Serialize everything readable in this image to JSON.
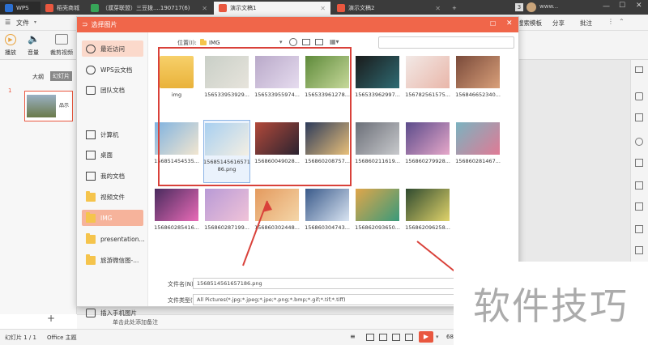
{
  "titlebar": {
    "tabs": [
      {
        "label": "WPS",
        "color": "#2b6fd1"
      },
      {
        "label": "稻壳商城",
        "color": "#e9573f"
      },
      {
        "label": "（濮芽联盟）三豆拨....190717(6)",
        "color": "#37a558"
      },
      {
        "label": "演示文稿1",
        "color": "#e9573f"
      },
      {
        "label": "演示文稿2",
        "color": "#e9573f"
      }
    ],
    "badge": "3",
    "user": "www..."
  },
  "menu": {
    "file": "文件",
    "search_template": "搜索模板",
    "share": "分享",
    "annotate": "批注"
  },
  "toolbar": {
    "play": "播放",
    "volume": "音量",
    "clip_video": "裁剪视频"
  },
  "leftpanel": {
    "outline": "大纲",
    "slides": "幻灯片",
    "slide_no": "1",
    "thumb_text": "品示"
  },
  "dialog": {
    "title": "选择图片",
    "location_label": "位置(I):",
    "location_value": "IMG",
    "sidebar": [
      {
        "label": "最近访问",
        "icon": "clock-icon"
      },
      {
        "label": "WPS云文档",
        "icon": "cloud-icon"
      },
      {
        "label": "团队文档",
        "icon": "team-icon"
      },
      {
        "label": "计算机",
        "icon": "computer-icon"
      },
      {
        "label": "桌面",
        "icon": "desktop-icon"
      },
      {
        "label": "我的文档",
        "icon": "documents-icon"
      },
      {
        "label": "视频文件",
        "icon": "folder-icon"
      },
      {
        "label": "IMG",
        "icon": "folder-icon"
      },
      {
        "label": "presentation...",
        "icon": "folder-icon"
      },
      {
        "label": "旅游微信图-...",
        "icon": "folder-icon"
      }
    ],
    "insert_phone": "插入手机图片",
    "files": [
      {
        "name": "img",
        "kind": "folder"
      },
      {
        "name": "156533953929...",
        "colors": [
          "#c9cfc7",
          "#e7e4dc"
        ]
      },
      {
        "name": "156533955974...",
        "colors": [
          "#b9a9c9",
          "#e6dcef"
        ]
      },
      {
        "name": "156533961278...",
        "colors": [
          "#5e8a3a",
          "#c7d99b"
        ]
      },
      {
        "name": "156533962997...",
        "colors": [
          "#1a1a1a",
          "#2f6c74"
        ]
      },
      {
        "name": "156782561575...",
        "colors": [
          "#f2e9e6",
          "#e9b6a9"
        ]
      },
      {
        "name": "156846652340...",
        "colors": [
          "#7a4a3a",
          "#d9a07a"
        ]
      },
      {
        "name": "156851454535...",
        "colors": [
          "#7fb2e0",
          "#f2e6d0"
        ]
      },
      {
        "name": "15685145616571 86.png",
        "colors": [
          "#a8cff0",
          "#f4efe3"
        ]
      },
      {
        "name": "156860049028...",
        "colors": [
          "#b2493a",
          "#2b2330"
        ]
      },
      {
        "name": "156860208757...",
        "colors": [
          "#2d3b5a",
          "#e9c07a"
        ]
      },
      {
        "name": "156860211619...",
        "colors": [
          "#6b6f78",
          "#c8c9cc"
        ]
      },
      {
        "name": "156860279928...",
        "colors": [
          "#5b4b8a",
          "#e6a7c9"
        ]
      },
      {
        "name": "156860281467...",
        "colors": [
          "#7ab3c0",
          "#e07a95"
        ]
      },
      {
        "name": "156860285416...",
        "colors": [
          "#4a2b5e",
          "#e96bb7"
        ]
      },
      {
        "name": "156860287199...",
        "colors": [
          "#b89ad6",
          "#f0c3d8"
        ]
      },
      {
        "name": "156860302448...",
        "colors": [
          "#e49a5e",
          "#f4d6a8"
        ]
      },
      {
        "name": "156860304743...",
        "colors": [
          "#3a5a8a",
          "#d9e4f2"
        ]
      },
      {
        "name": "156862093650...",
        "colors": [
          "#e0a64a",
          "#3a9a7a"
        ]
      },
      {
        "name": "156862096258...",
        "colors": [
          "#2f4a2f",
          "#e0d36a"
        ]
      }
    ],
    "filename_label": "文件名(N):",
    "filename_value": "1568514561657186.png",
    "filetype_label": "文件类型(T):",
    "filetype_value": "All Pictures(*.jpg;*.jpeg;*.jpe;*.png;*.bmp;*.gif;*.tif;*.tiff)"
  },
  "notes": "单击此处添加备注",
  "status": {
    "slide_count": "幻灯片 1 / 1",
    "theme": "Office 主题",
    "zoom": "68"
  },
  "watermark": "软件技巧",
  "colors": {
    "accent": "#f0664a",
    "highlight": "#d9413a"
  }
}
